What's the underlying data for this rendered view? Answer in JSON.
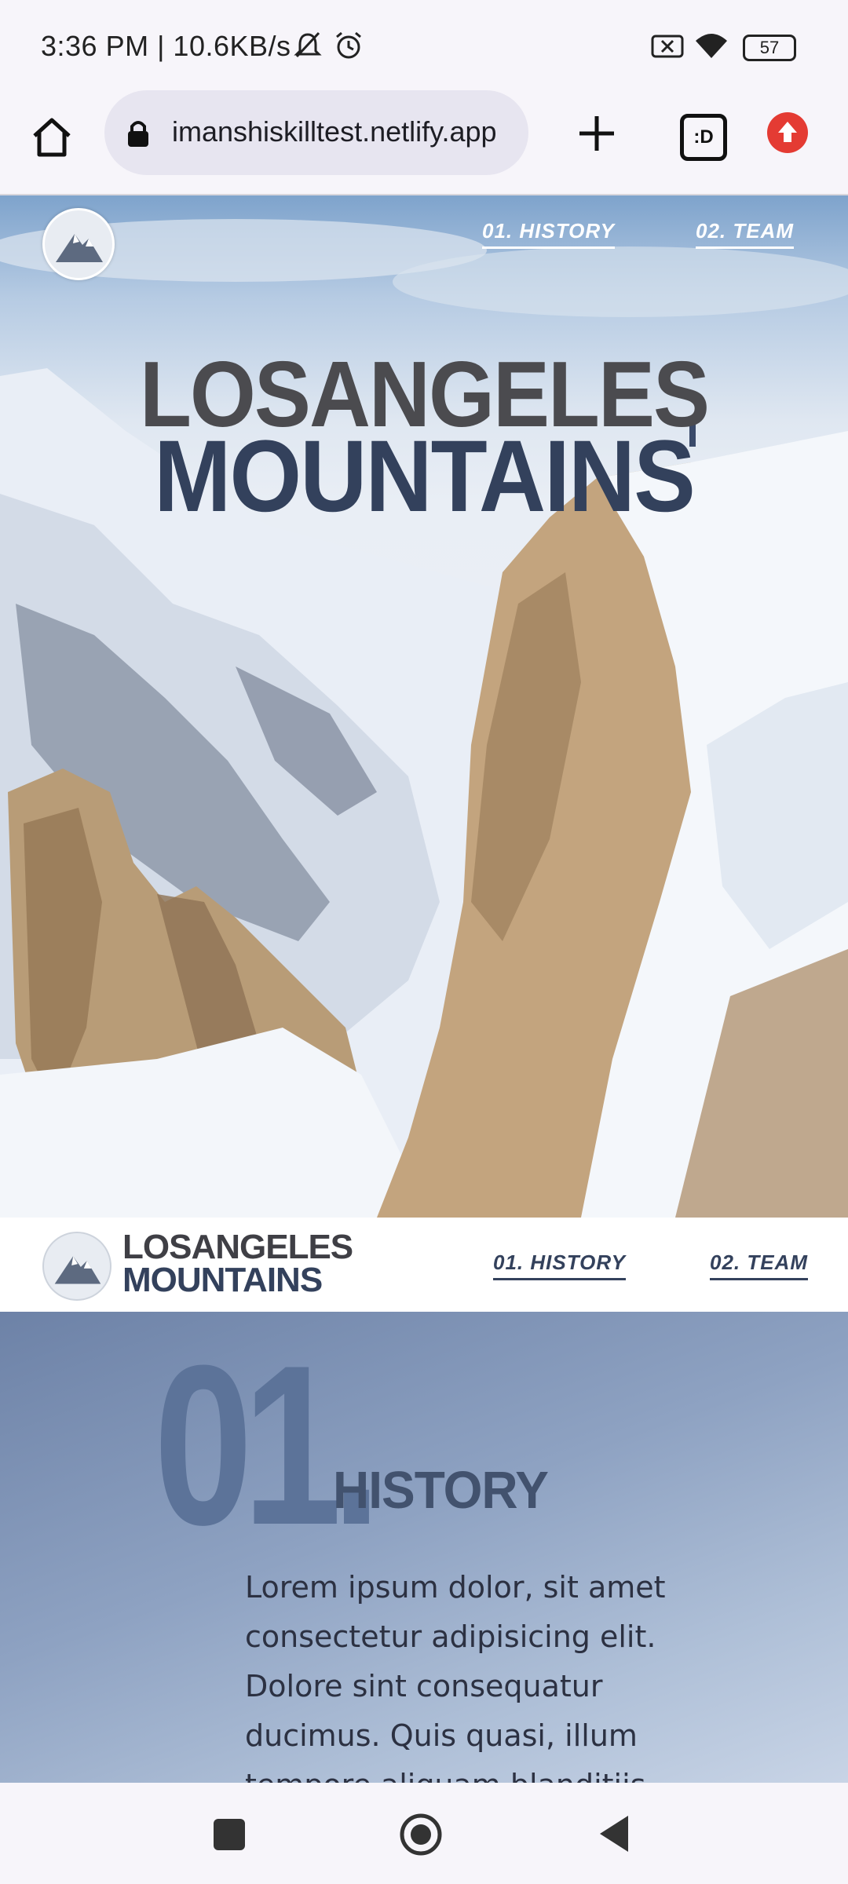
{
  "status_bar": {
    "time_speed": "3:36 PM | 10.6KB/s",
    "battery": "57",
    "icons": [
      "mute-icon",
      "alarm-icon",
      "data-off-icon",
      "wifi-icon",
      "battery-icon"
    ]
  },
  "browser": {
    "url": "imanshiskilltest.netlify.app",
    "tabs_label": ":D",
    "icons": [
      "home-icon",
      "lock-icon",
      "plus-icon",
      "tabs-icon",
      "update-icon"
    ]
  },
  "hero": {
    "nav": [
      "01. HISTORY",
      "02. TEAM"
    ],
    "title_line1": "LOSANGELES",
    "title_line2": "MOUNTAINS"
  },
  "site_nav": {
    "brand_line1": "LOSANGELES",
    "brand_line2": "MOUNTAINS",
    "links": [
      "01. HISTORY",
      "02. TEAM"
    ]
  },
  "history": {
    "number": "01.",
    "title": "HISTORY",
    "body": "Lorem ipsum dolor, sit amet consectetur adipisicing elit. Dolore sint consequatur ducimus. Quis quasi, illum tempore aliquam blanditiis neque praesentium"
  },
  "colors": {
    "brand_navy": "#33415c",
    "brand_gray": "#4b4b4f",
    "history_bg": "#8ea2c2"
  }
}
